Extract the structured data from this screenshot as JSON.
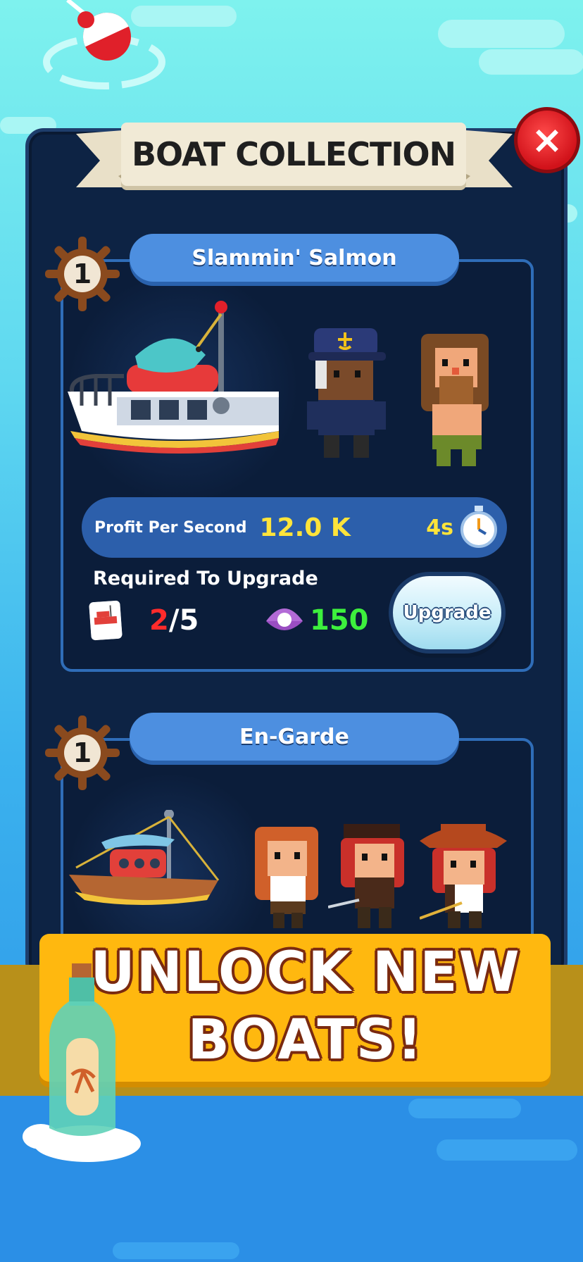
{
  "screen": {
    "title": "BOAT COLLECTION",
    "close_label": "×"
  },
  "boats": [
    {
      "name": "Slammin' Salmon",
      "level": "1",
      "profit_label": "Profit Per Second",
      "profit_value": "12.0 K",
      "cycle_time": "4s",
      "required_label": "Required To Upgrade",
      "cards_have": "2",
      "cards_sep_total": "/5",
      "pearls_cost": "150",
      "upgrade_label": "Upgrade"
    },
    {
      "name": "En-Garde",
      "level": "1"
    }
  ],
  "promo": {
    "line1": "UNLOCK NEW",
    "line2": "BOATS!"
  },
  "colors": {
    "panel": "#0d2344",
    "pill": "#4d8fe0",
    "profit_value": "#ffe43a",
    "pearls": "#3df03d",
    "cards_have": "#ff2b2b",
    "banner": "#ffb80f"
  }
}
